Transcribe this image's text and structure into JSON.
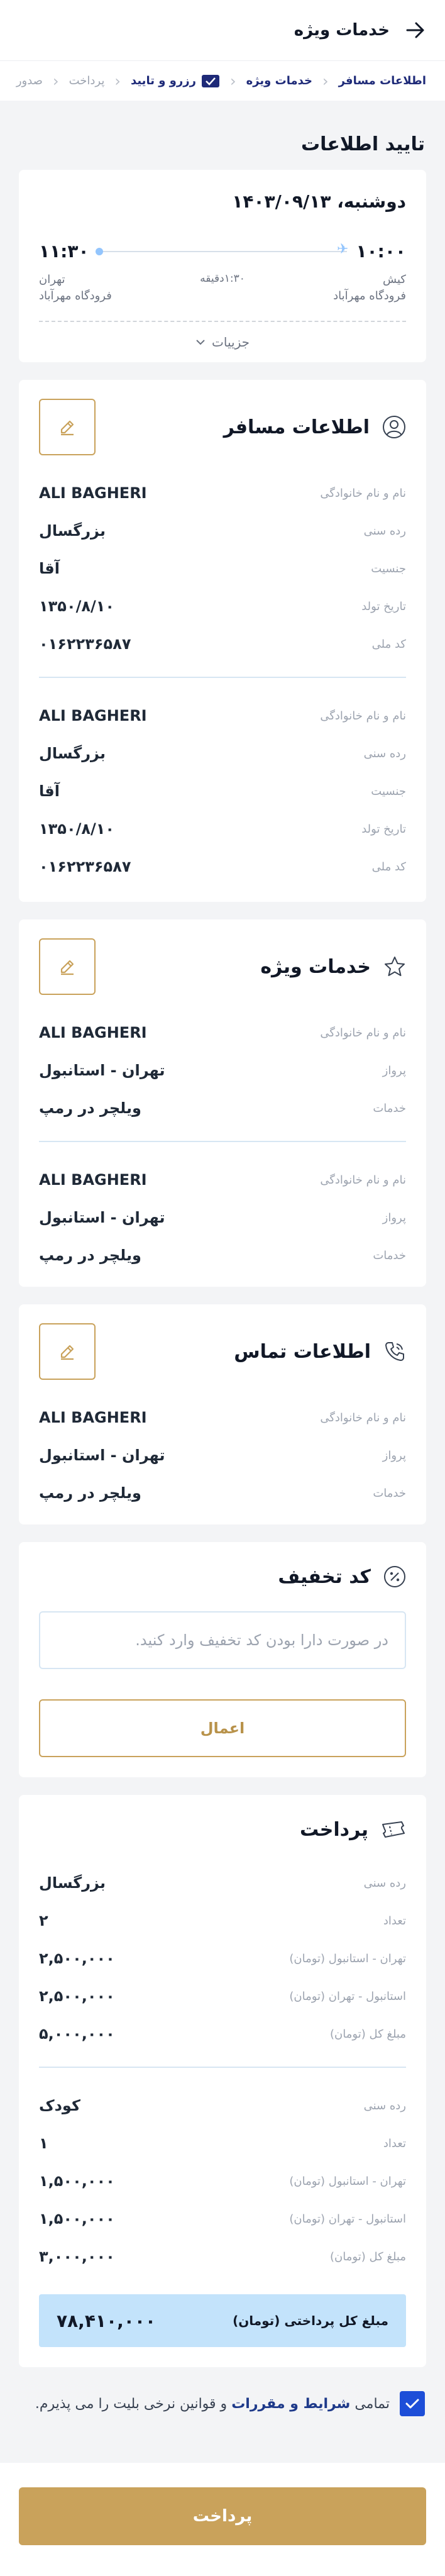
{
  "header": {
    "title": "خدمات ویژه",
    "back_icon": "arrow-right-icon"
  },
  "steps": [
    {
      "label": "اطلاعات مسافر",
      "state": "done"
    },
    {
      "label": "خدمات ویژه",
      "state": "done"
    },
    {
      "label": "رزرو و تایید",
      "state": "current"
    },
    {
      "label": "پرداخت",
      "state": "todo"
    },
    {
      "label": "صدور",
      "state": "todo"
    }
  ],
  "page_title": "تایید اطلاعات",
  "flight": {
    "date": "دوشنبه، ۱۴۰۳/۰۹/۱۳",
    "depart_time": "۱۰:۰۰",
    "arrive_time": "۱۱:۳۰",
    "duration": "۱:۳۰دقیقه",
    "origin_city": "کیش",
    "origin_airport": "فرودگاه مهرآباد",
    "dest_city": "تهران",
    "dest_airport": "فرودگاه مهرآباد",
    "details_label": "جزییات"
  },
  "passengers": {
    "title": "اطلاعات مسافر",
    "labels": {
      "name": "نام و نام خانوادگی",
      "age": "رده سنی",
      "gender": "جنسیت",
      "birth": "تاریخ تولد",
      "id": "کد ملی"
    },
    "items": [
      {
        "name": "ALI BAGHERI",
        "age": "بزرگسال",
        "gender": "آقا",
        "birth": "۱۳۵۰/۸/۱۰",
        "id": "۰۱۶۲۲۳۶۵۸۷"
      },
      {
        "name": "ALI BAGHERI",
        "age": "بزرگسال",
        "gender": "آقا",
        "birth": "۱۳۵۰/۸/۱۰",
        "id": "۰۱۶۲۲۳۶۵۸۷"
      }
    ]
  },
  "services": {
    "title": "خدمات ویژه",
    "labels": {
      "name": "نام و نام خانوادگی",
      "flight": "پرواز",
      "service": "خدمات"
    },
    "items": [
      {
        "name": "ALI BAGHERI",
        "flight": "تهران - استانبول",
        "service": "ویلچر در رمپ"
      },
      {
        "name": "ALI BAGHERI",
        "flight": "تهران - استانبول",
        "service": "ویلچر در رمپ"
      }
    ]
  },
  "contact": {
    "title": "اطلاعات تماس",
    "labels": {
      "name": "نام و نام خانوادگی",
      "flight": "پرواز",
      "service": "خدمات"
    },
    "item": {
      "name": "ALI BAGHERI",
      "flight": "تهران - استانبول",
      "service": "ویلچر در رمپ"
    }
  },
  "discount": {
    "title": "کد تخفیف",
    "placeholder": "در صورت دارا بودن کد تخفیف وارد کنید.",
    "apply_label": "اعمال"
  },
  "payment": {
    "title": "پرداخت",
    "labels": {
      "age": "رده سنی",
      "count": "تعداد",
      "out": "تهران - استانبول (تومان)",
      "back": "استانبول - تهران (تومان)",
      "sum": "مبلغ کل (تومان)"
    },
    "groups": [
      {
        "age": "بزرگسال",
        "count": "۲",
        "out": "۲,۵۰۰,۰۰۰",
        "back": "۲,۵۰۰,۰۰۰",
        "sum": "۵,۰۰۰,۰۰۰"
      },
      {
        "age": "کودک",
        "count": "۱",
        "out": "۱,۵۰۰,۰۰۰",
        "back": "۱,۵۰۰,۰۰۰",
        "sum": "۳,۰۰۰,۰۰۰"
      }
    ],
    "total_label": "مبلغ کل پرداختی (تومان)",
    "total_value": "۷۸,۴۱۰,۰۰۰"
  },
  "terms": {
    "pre": "تمامی",
    "link": "شرایط و مقررات",
    "post": "و قوانین نرخی بلیت را می پذیرم.",
    "checked": true
  },
  "pay_button": "پرداخت",
  "colors": {
    "accent": "#c9a25b",
    "primary": "#1e2a78",
    "highlight": "#c3e3fb"
  }
}
